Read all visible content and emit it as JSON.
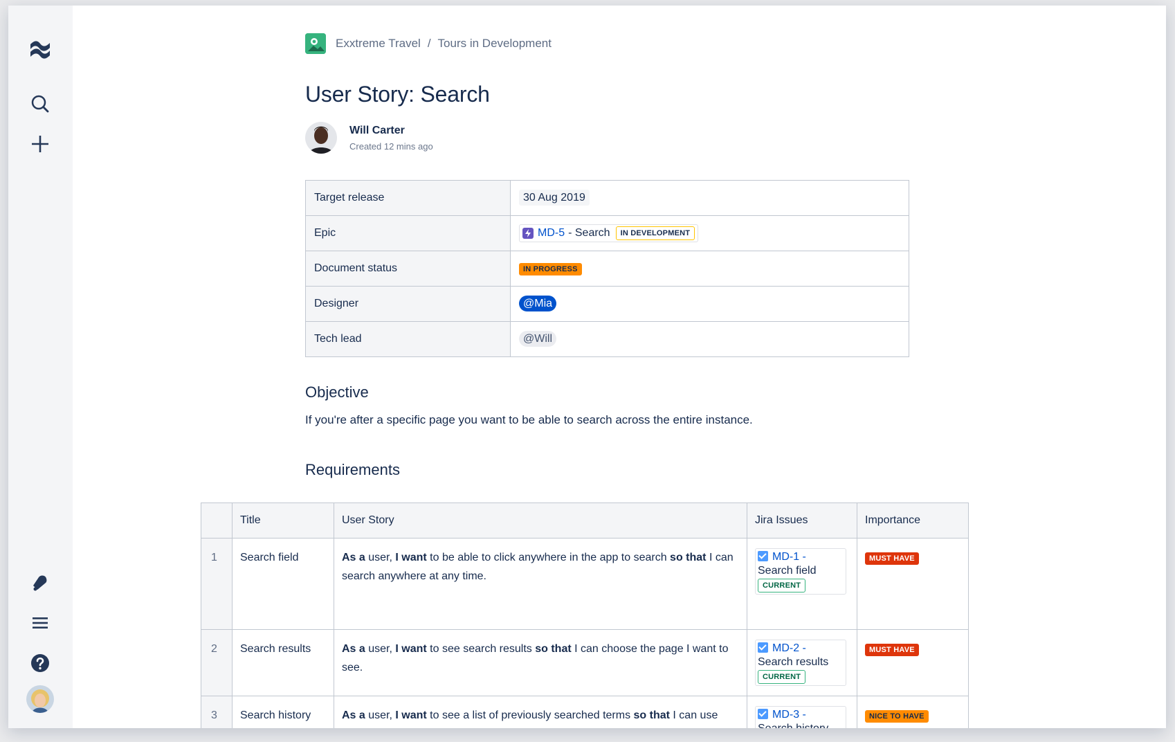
{
  "breadcrumb": {
    "space": "Exxtreme Travel",
    "separator": "/",
    "page": "Tours in Development"
  },
  "page": {
    "title": "User Story: Search",
    "author": "Will Carter",
    "created": "Created 12 mins ago"
  },
  "properties": {
    "target_release_label": "Target release",
    "target_release_value": "30 Aug 2019",
    "epic_label": "Epic",
    "epic_key": "MD-5",
    "epic_summary": "- Search",
    "epic_status": "IN DEVELOPMENT",
    "doc_status_label": "Document status",
    "doc_status_value": "IN PROGRESS",
    "designer_label": "Designer",
    "designer_value": "@Mia",
    "tech_lead_label": "Tech lead",
    "tech_lead_value": "@Will"
  },
  "objective": {
    "heading": "Objective",
    "text": "If you're after a specific page you want to be able to search across the entire instance."
  },
  "requirements": {
    "heading": "Requirements",
    "columns": [
      "",
      "Title",
      "User Story",
      "Jira Issues",
      "Importance"
    ],
    "rows": [
      {
        "num": "1",
        "title": "Search field",
        "story": {
          "as_a": "As a",
          "user": " user, ",
          "i_want": "I want",
          "middle": " to be able to click anywhere in the app to search ",
          "so_that": "so that",
          "end": " I can search anywhere at any time."
        },
        "issue_key": "MD-1 -",
        "issue_summary": "Search field",
        "issue_status": "CURRENT",
        "importance": "MUST HAVE"
      },
      {
        "num": "2",
        "title": "Search results",
        "story": {
          "as_a": "As a",
          "user": " user, ",
          "i_want": "I want",
          "middle": " to see search results ",
          "so_that": "so that",
          "end": " I can choose the page I want to see."
        },
        "issue_key": "MD-2 -",
        "issue_summary": "Search results",
        "issue_status": "CURRENT",
        "importance": "MUST HAVE"
      },
      {
        "num": "3",
        "title": "Search history",
        "story": {
          "as_a": "As a",
          "user": " user, ",
          "i_want": "I want",
          "middle": " to see a list of previously searched terms ",
          "so_that": "so that",
          "end": " I can use them as shortcuts to re-searching"
        },
        "issue_key": "MD-3 -",
        "issue_summary": "Search history",
        "issue_status": "",
        "importance": "NICE TO HAVE"
      }
    ]
  },
  "colors": {
    "must_have": "#de350b",
    "nice_to_have": "#ff8b00",
    "in_progress": "#ff8b00",
    "link": "#0052cc",
    "current": "#36b37e"
  },
  "icons": [
    "confluence-logo-icon",
    "search-icon",
    "plus-icon",
    "notification-icon",
    "menu-icon",
    "help-icon"
  ]
}
